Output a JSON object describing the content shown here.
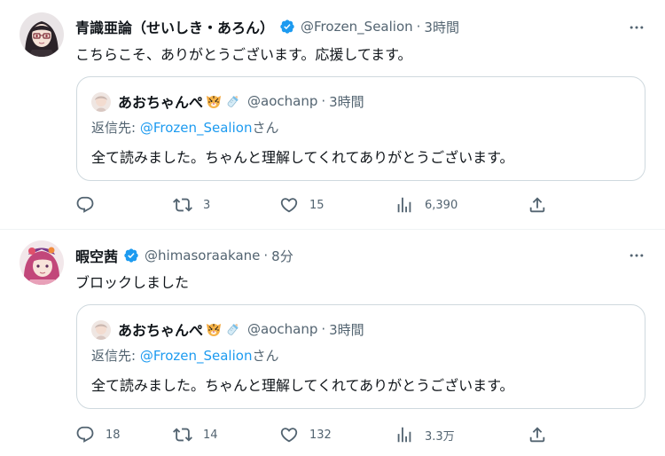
{
  "colors": {
    "text": "#0f1419",
    "secondary": "#536471",
    "link": "#1d9bf0",
    "verified": "#1d9bf0",
    "border": "#cfd9de"
  },
  "tweets": [
    {
      "display_name": "青識亜論（せいしき・あろん）",
      "verified": true,
      "handle": "@Frozen_Sealion",
      "dot": "·",
      "time": "3時間",
      "text": "こちらこそ、ありがとうございます。応援してます。",
      "quote": {
        "display_name": "あおちゃんぺ",
        "emoji": [
          "tiger-face-icon",
          "baby-bottle-icon"
        ],
        "handle": "@aochanp",
        "dot": "·",
        "time": "3時間",
        "reply_prefix": "返信先: ",
        "reply_to": "@Frozen_Sealion",
        "reply_suffix": "さん",
        "text": "全て読みました。ちゃんと理解してくれてありがとうございます。"
      },
      "actions": {
        "reply_count": "",
        "retweet_count": "3",
        "like_count": "15",
        "view_count": "6,390"
      }
    },
    {
      "display_name": "暇空茜",
      "verified": true,
      "handle": "@himasoraakane",
      "dot": "·",
      "time": "8分",
      "text": "ブロックしました",
      "quote": {
        "display_name": "あおちゃんぺ",
        "emoji": [
          "tiger-face-icon",
          "baby-bottle-icon"
        ],
        "handle": "@aochanp",
        "dot": "·",
        "time": "3時間",
        "reply_prefix": "返信先: ",
        "reply_to": "@Frozen_Sealion",
        "reply_suffix": "さん",
        "text": "全て読みました。ちゃんと理解してくれてありがとうございます。"
      },
      "actions": {
        "reply_count": "18",
        "retweet_count": "14",
        "like_count": "132",
        "view_count": "3.3万"
      }
    }
  ]
}
